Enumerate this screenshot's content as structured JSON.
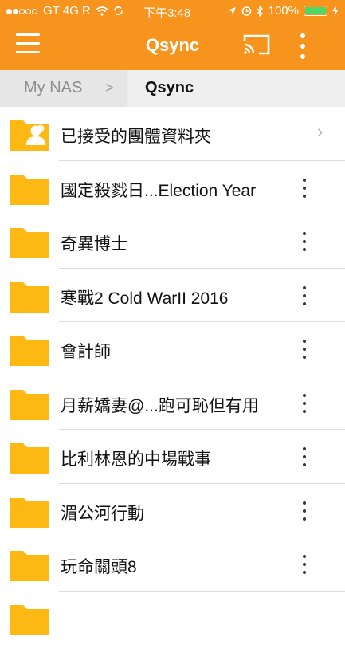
{
  "status_bar": {
    "carrier": "GT 4G R",
    "time": "下午3:48",
    "battery": "100%"
  },
  "navbar": {
    "title": "Qsync"
  },
  "breadcrumb": {
    "root": "My NAS",
    "separator": ">",
    "current": "Qsync"
  },
  "items": [
    {
      "label": "已接受的團體資料夾",
      "type": "shared-folder"
    },
    {
      "label": "國定殺戮日...Election Year",
      "type": "folder"
    },
    {
      "label": "奇異博士",
      "type": "folder"
    },
    {
      "label": "寒戰2 Cold WarII 2016",
      "type": "folder"
    },
    {
      "label": "會計師",
      "type": "folder"
    },
    {
      "label": "月薪嬌妻@...跑可恥但有用",
      "type": "folder"
    },
    {
      "label": "比利林恩的中場戰事",
      "type": "folder"
    },
    {
      "label": "湄公河行動",
      "type": "folder"
    },
    {
      "label": "玩命關頭8",
      "type": "folder"
    }
  ],
  "colors": {
    "accent": "#f7941d",
    "folder": "#fdb813"
  }
}
